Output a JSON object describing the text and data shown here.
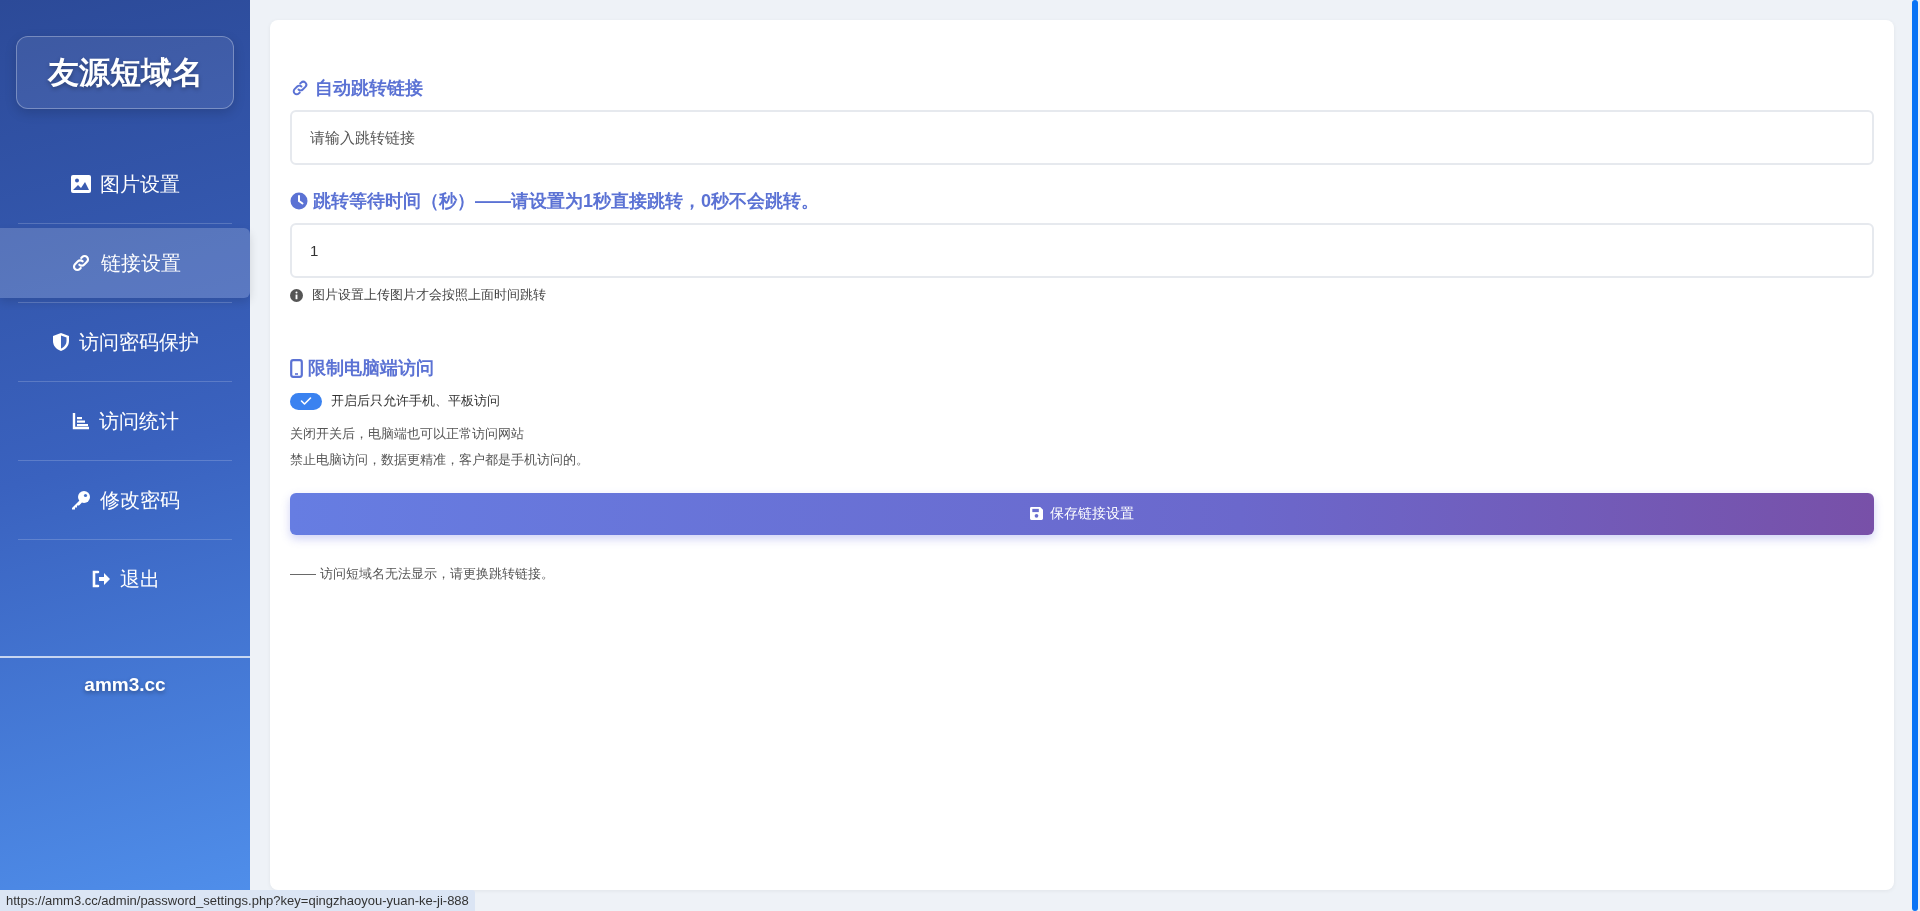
{
  "sidebar": {
    "logo": "友源短域名",
    "items": [
      {
        "label": "图片设置",
        "selected": false
      },
      {
        "label": "链接设置",
        "selected": true
      },
      {
        "label": "访问密码保护",
        "selected": false
      },
      {
        "label": "访问统计",
        "selected": false
      },
      {
        "label": "修改密码",
        "selected": false
      },
      {
        "label": "退出",
        "selected": false
      }
    ],
    "footer": "amm3.cc"
  },
  "redirect_link": {
    "title": "自动跳转链接",
    "placeholder": "请输入跳转链接"
  },
  "wait_time": {
    "title": "跳转等待时间（秒）——请设置为1秒直接跳转，0秒不会跳转。",
    "value": "1",
    "hint": "图片设置上传图片才会按照上面时间跳转"
  },
  "pc_restriction": {
    "title": "限制电脑端访问",
    "toggle": {
      "label": "开启后只允许手机、平板访问",
      "on": true
    },
    "notes": [
      "关闭开关后，电脑端也可以正常访问网站",
      "禁止电脑访问，数据更精准，客户都是手机访问的。"
    ]
  },
  "save_button": "保存链接设置",
  "footer_note": "—— 访问短域名无法显示，请更换跳转链接。",
  "status_url": "https://amm3.cc/admin/password_settings.php?key=qingzhaoyou-yuan-ke-ji-888"
}
